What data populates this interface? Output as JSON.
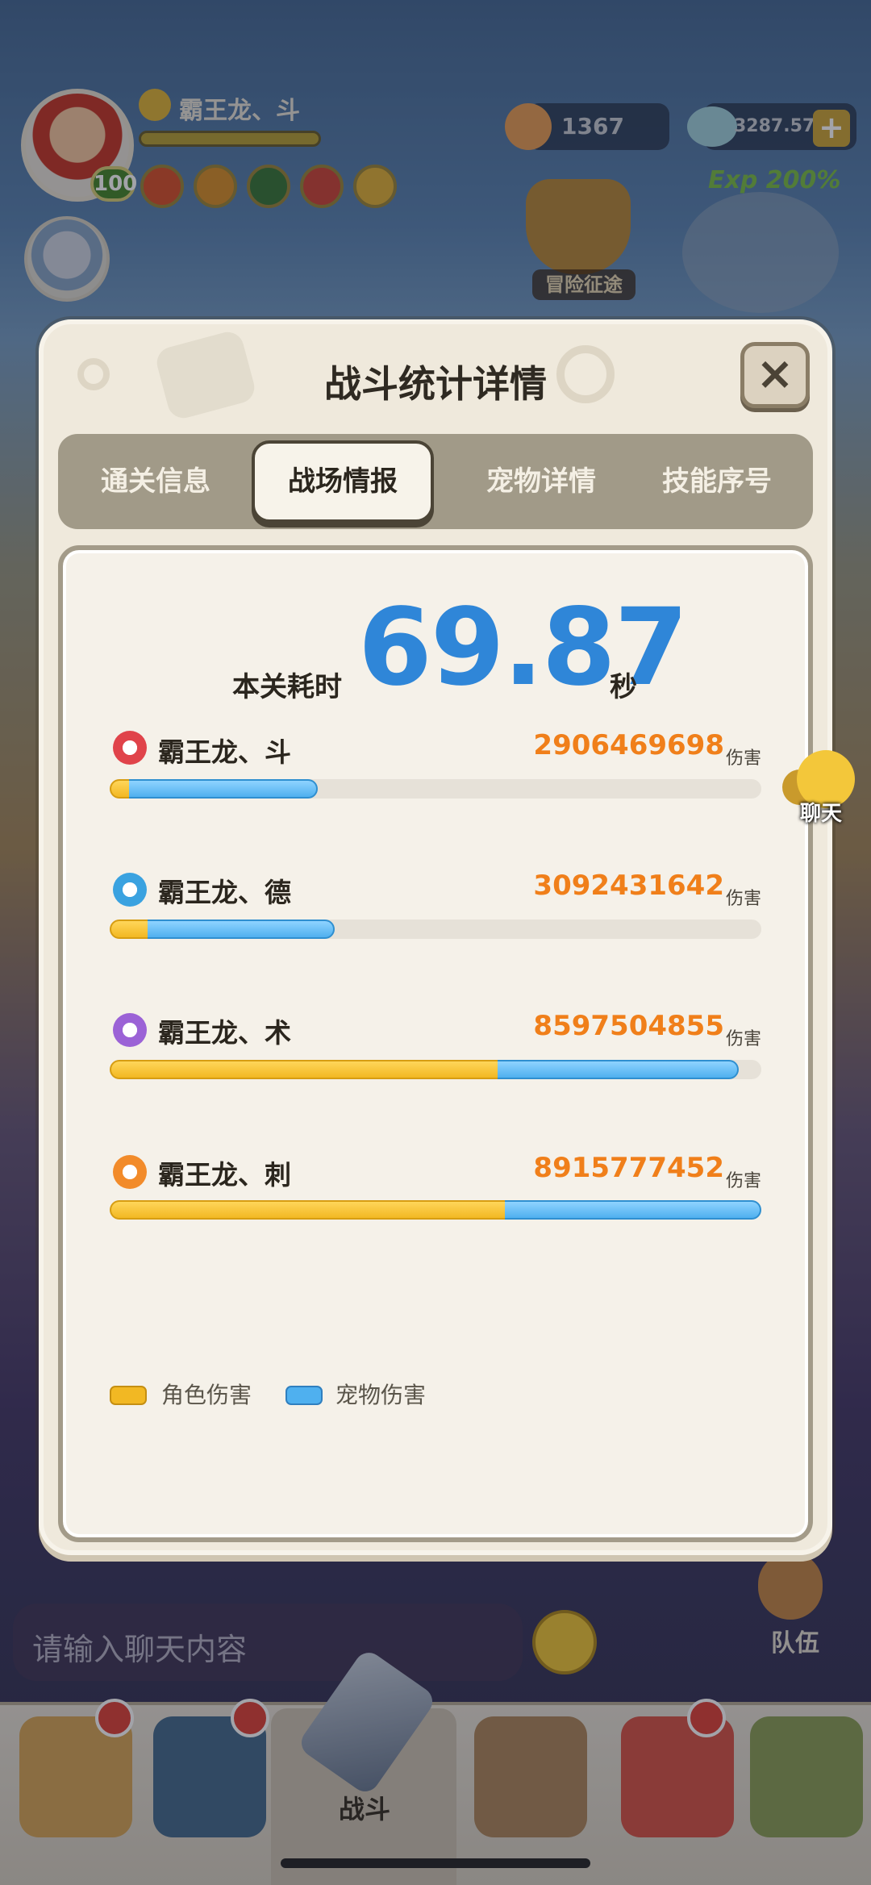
{
  "hud": {
    "player_name": "霸王龙、斗",
    "player_level": "100",
    "gold": "1367",
    "gems": "3287.57M",
    "exp": "Exp 200%",
    "adventure": "冒险征途"
  },
  "dialog": {
    "title": "战斗统计详情",
    "close": "×",
    "tabs": [
      {
        "label": "通关信息",
        "active": false
      },
      {
        "label": "战场情报",
        "active": true
      },
      {
        "label": "宠物详情",
        "active": false
      },
      {
        "label": "技能序号",
        "active": false
      }
    ],
    "time_label": "本关耗时",
    "time_value": "69.87",
    "time_unit": "秒",
    "damage_unit": "伤害",
    "rows": [
      {
        "name": "霸王龙、斗",
        "damage": "2906469698",
        "role_share": 0.03,
        "pet_share": 0.29,
        "icon": "red-fist-icon",
        "icon_color": "#e0434a"
      },
      {
        "name": "霸王龙、德",
        "damage": "3092431642",
        "role_share": 0.058,
        "pet_share": 0.287,
        "icon": "blue-swirl-icon",
        "icon_color": "#3aa2e0"
      },
      {
        "name": "霸王龙、术",
        "damage": "8597504855",
        "role_share": 0.595,
        "pet_share": 0.37,
        "icon": "purple-spiral-icon",
        "icon_color": "#9b62d6"
      },
      {
        "name": "霸王龙、刺",
        "damage": "8915777452",
        "role_share": 0.607,
        "pet_share": 0.393,
        "icon": "orange-blade-icon",
        "icon_color": "#f28b2a"
      }
    ],
    "legend": {
      "role": "角色伤害",
      "pet": "宠物伤害",
      "role_color": "#f2b823",
      "pet_color": "#4fb0ef"
    }
  },
  "chat": {
    "float_label": "聊天",
    "input_placeholder": "请输入聊天内容"
  },
  "nav": {
    "center_label": "战斗",
    "team_label": "队伍"
  }
}
